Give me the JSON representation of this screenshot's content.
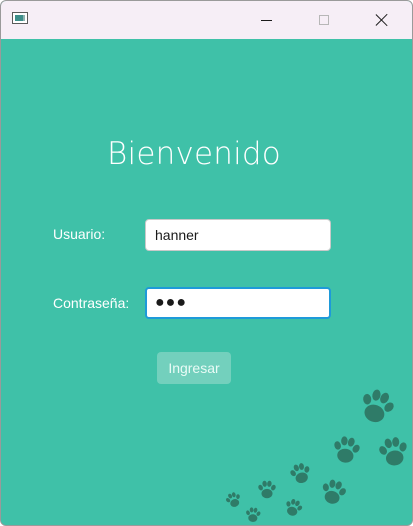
{
  "window": {
    "icons": {
      "app": "app-window-icon",
      "minimize": "minimize-icon",
      "maximize": "maximize-icon",
      "close": "close-icon"
    }
  },
  "login": {
    "heading": "Bienvenido",
    "username_label": "Usuario:",
    "username_value": "hanner",
    "password_label": "Contraseña:",
    "password_value": "●●●",
    "submit_label": "Ingresar"
  },
  "decoration": {
    "icon": "paw-print-icon",
    "color": "#2f7b68"
  },
  "colors": {
    "background": "#3fc1a8",
    "titlebar": "#f6eef6",
    "button": "#73d0bd",
    "focus_border": "#1e9ad9"
  }
}
